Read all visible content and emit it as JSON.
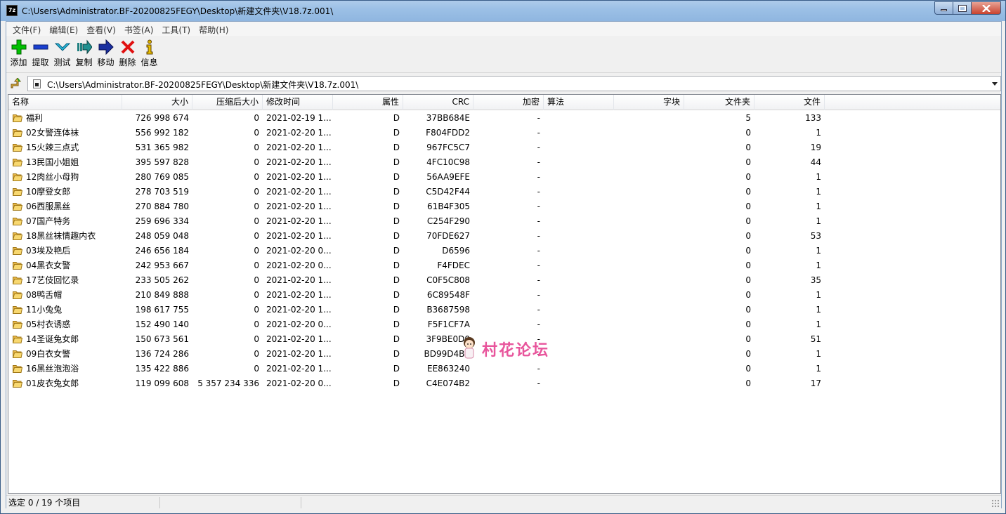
{
  "window": {
    "title": "C:\\Users\\Administrator.BF-20200825FEGY\\Desktop\\新建文件夹\\V18.7z.001\\",
    "icon_text": "7z"
  },
  "menu": [
    "文件(F)",
    "编辑(E)",
    "查看(V)",
    "书签(A)",
    "工具(T)",
    "帮助(H)"
  ],
  "toolbar": [
    {
      "label": "添加",
      "icon": "add-icon",
      "color": "#00b000"
    },
    {
      "label": "提取",
      "icon": "extract-icon",
      "color": "#1a3fd0"
    },
    {
      "label": "测试",
      "icon": "test-icon",
      "color": "#20a8c8"
    },
    {
      "label": "复制",
      "icon": "copy-icon",
      "color": "#208080"
    },
    {
      "label": "移动",
      "icon": "move-icon",
      "color": "#1a2fa0"
    },
    {
      "label": "删除",
      "icon": "delete-icon",
      "color": "#e01010"
    },
    {
      "label": "信息",
      "icon": "info-icon",
      "color": "#c8a000"
    }
  ],
  "address": {
    "path": "C:\\Users\\Administrator.BF-20200825FEGY\\Desktop\\新建文件夹\\V18.7z.001\\"
  },
  "columns": [
    "名称",
    "大小",
    "压缩后大小",
    "修改时间",
    "属性",
    "CRC",
    "加密",
    "算法",
    "字块",
    "文件夹",
    "文件"
  ],
  "rows": [
    {
      "name": "福利",
      "size": "726 998 674",
      "packed": "0",
      "mtime": "2021-02-19 1...",
      "attr": "D",
      "crc": "37BB684E",
      "enc": "-",
      "method": "",
      "block": "",
      "folders": "5",
      "files": "133"
    },
    {
      "name": "02女警连体袜",
      "size": "556 992 182",
      "packed": "0",
      "mtime": "2021-02-20 1...",
      "attr": "D",
      "crc": "F804FDD2",
      "enc": "-",
      "method": "",
      "block": "",
      "folders": "0",
      "files": "1"
    },
    {
      "name": "15火辣三点式",
      "size": "531 365 982",
      "packed": "0",
      "mtime": "2021-02-20 1...",
      "attr": "D",
      "crc": "967FC5C7",
      "enc": "-",
      "method": "",
      "block": "",
      "folders": "0",
      "files": "19"
    },
    {
      "name": "13民国小姐姐",
      "size": "395 597 828",
      "packed": "0",
      "mtime": "2021-02-20 1...",
      "attr": "D",
      "crc": "4FC10C98",
      "enc": "-",
      "method": "",
      "block": "",
      "folders": "0",
      "files": "44"
    },
    {
      "name": "12肉丝小母狗",
      "size": "280 769 085",
      "packed": "0",
      "mtime": "2021-02-20 1...",
      "attr": "D",
      "crc": "56AA9EFE",
      "enc": "-",
      "method": "",
      "block": "",
      "folders": "0",
      "files": "1"
    },
    {
      "name": "10摩登女郎",
      "size": "278 703 519",
      "packed": "0",
      "mtime": "2021-02-20 1...",
      "attr": "D",
      "crc": "C5D42F44",
      "enc": "-",
      "method": "",
      "block": "",
      "folders": "0",
      "files": "1"
    },
    {
      "name": "06西服黑丝",
      "size": "270 884 780",
      "packed": "0",
      "mtime": "2021-02-20 1...",
      "attr": "D",
      "crc": "61B4F305",
      "enc": "-",
      "method": "",
      "block": "",
      "folders": "0",
      "files": "1"
    },
    {
      "name": "07国产特务",
      "size": "259 696 334",
      "packed": "0",
      "mtime": "2021-02-20 1...",
      "attr": "D",
      "crc": "C254F290",
      "enc": "-",
      "method": "",
      "block": "",
      "folders": "0",
      "files": "1"
    },
    {
      "name": "18黑丝袜情趣内衣",
      "size": "248 059 048",
      "packed": "0",
      "mtime": "2021-02-20 1...",
      "attr": "D",
      "crc": "70FDE627",
      "enc": "-",
      "method": "",
      "block": "",
      "folders": "0",
      "files": "53"
    },
    {
      "name": "03埃及艳后",
      "size": "246 656 184",
      "packed": "0",
      "mtime": "2021-02-20 0...",
      "attr": "D",
      "crc": "D6596",
      "enc": "-",
      "method": "",
      "block": "",
      "folders": "0",
      "files": "1"
    },
    {
      "name": "04黑衣女警",
      "size": "242 953 667",
      "packed": "0",
      "mtime": "2021-02-20 0...",
      "attr": "D",
      "crc": "F4FDEC",
      "enc": "-",
      "method": "",
      "block": "",
      "folders": "0",
      "files": "1"
    },
    {
      "name": "17艺伎回忆录",
      "size": "233 505 262",
      "packed": "0",
      "mtime": "2021-02-20 1...",
      "attr": "D",
      "crc": "C0F5C808",
      "enc": "-",
      "method": "",
      "block": "",
      "folders": "0",
      "files": "35"
    },
    {
      "name": "08鸭舌帽",
      "size": "210 849 888",
      "packed": "0",
      "mtime": "2021-02-20 1...",
      "attr": "D",
      "crc": "6C89548F",
      "enc": "-",
      "method": "",
      "block": "",
      "folders": "0",
      "files": "1"
    },
    {
      "name": "11小兔兔",
      "size": "198 617 755",
      "packed": "0",
      "mtime": "2021-02-20 1...",
      "attr": "D",
      "crc": "B3687598",
      "enc": "-",
      "method": "",
      "block": "",
      "folders": "0",
      "files": "1"
    },
    {
      "name": "05村衣诱惑",
      "size": "152 490 140",
      "packed": "0",
      "mtime": "2021-02-20 0...",
      "attr": "D",
      "crc": "F5F1CF7A",
      "enc": "-",
      "method": "",
      "block": "",
      "folders": "0",
      "files": "1"
    },
    {
      "name": "14圣诞兔女郎",
      "size": "150 673 561",
      "packed": "0",
      "mtime": "2021-02-20 1...",
      "attr": "D",
      "crc": "3F9BE0D0",
      "enc": "-",
      "method": "",
      "block": "",
      "folders": "0",
      "files": "51"
    },
    {
      "name": "09白衣女警",
      "size": "136 724 286",
      "packed": "0",
      "mtime": "2021-02-20 1...",
      "attr": "D",
      "crc": "BD99D4B6",
      "enc": "-",
      "method": "",
      "block": "",
      "folders": "0",
      "files": "1"
    },
    {
      "name": "16黑丝泡泡浴",
      "size": "135 422 886",
      "packed": "0",
      "mtime": "2021-02-20 1...",
      "attr": "D",
      "crc": "EE863240",
      "enc": "-",
      "method": "",
      "block": "",
      "folders": "0",
      "files": "1"
    },
    {
      "name": "01皮衣兔女郎",
      "size": "119 099 608",
      "packed": "5 357 234 336",
      "mtime": "2021-02-20 0...",
      "attr": "D",
      "crc": "C4E074B2",
      "enc": "-",
      "method": "",
      "block": "",
      "folders": "0",
      "files": "17"
    }
  ],
  "watermark": "村花论坛",
  "status": {
    "selection": "选定 0 / 19 个项目"
  }
}
